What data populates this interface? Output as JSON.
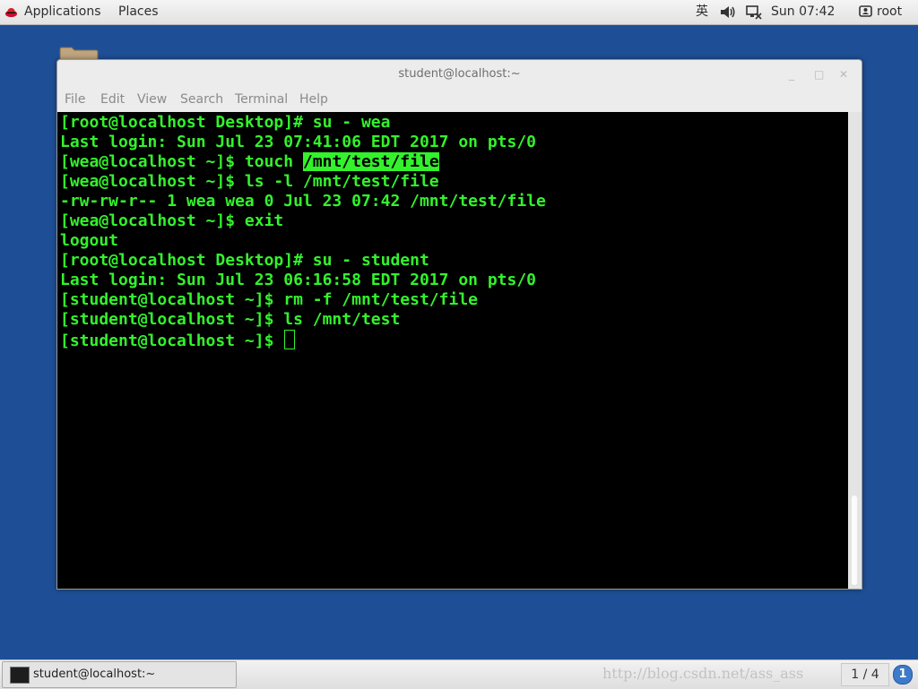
{
  "topbar": {
    "applications": "Applications",
    "places": "Places",
    "input_method": "英",
    "clock": "Sun 07:42",
    "user": "root"
  },
  "window": {
    "title": "student@localhost:~",
    "controls": [
      "_",
      "□",
      "✕"
    ],
    "menu": [
      "File",
      "Edit",
      "View",
      "Search",
      "Terminal",
      "Help"
    ]
  },
  "terminal": {
    "lines": [
      {
        "text": "[root@localhost Desktop]# su - wea"
      },
      {
        "text": "Last login: Sun Jul 23 07:41:06 EDT 2017 on pts/0"
      },
      {
        "text": "[wea@localhost ~]$ touch ",
        "highlight": "/mnt/test/file"
      },
      {
        "text": "[wea@localhost ~]$ ls -l /mnt/test/file"
      },
      {
        "text": "-rw-rw-r-- 1 wea wea 0 Jul 23 07:42 /mnt/test/file"
      },
      {
        "text": "[wea@localhost ~]$ exit"
      },
      {
        "text": "logout"
      },
      {
        "text": "[root@localhost Desktop]# su - student"
      },
      {
        "text": "Last login: Sun Jul 23 06:16:58 EDT 2017 on pts/0"
      },
      {
        "text": "[student@localhost ~]$ rm -f /mnt/test/file"
      },
      {
        "text": "[student@localhost ~]$ ls /mnt/test"
      },
      {
        "text": "[student@localhost ~]$ ",
        "cursor": true
      }
    ]
  },
  "taskbar": {
    "task_label": "student@localhost:~",
    "watermark": "http://blog.csdn.net/ass_ass",
    "workspace": "1 / 4",
    "notification": "1"
  },
  "colors": {
    "desktop": "#1e4f96",
    "terminal_bg": "#000000",
    "terminal_fg": "#33f22c"
  },
  "icons": {
    "app_logo": "redhat-logo-icon",
    "volume": "speaker-icon",
    "network": "network-icon",
    "user": "user-icon",
    "folder": "folder-icon",
    "terminal": "terminal-icon"
  }
}
